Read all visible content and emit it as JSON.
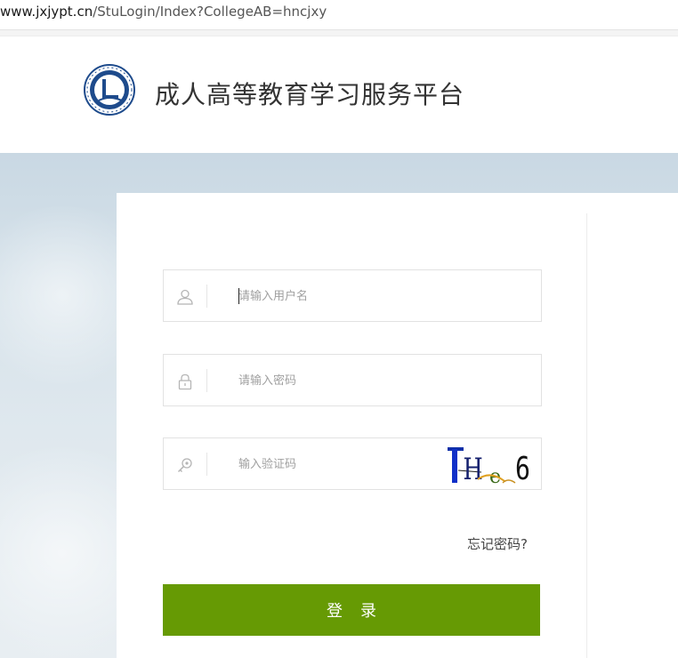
{
  "browser": {
    "url_host": "www.jxjypt.cn",
    "url_path": "/StuLogin/Index?CollegeAB=hncjxy"
  },
  "header": {
    "site_title": "成人高等教育学习服务平台",
    "logo_icon": "university-seal-icon"
  },
  "login_form": {
    "username": {
      "placeholder": "请输入用户名",
      "value": "",
      "icon": "user-icon"
    },
    "password": {
      "placeholder": "请输入密码",
      "value": "",
      "icon": "lock-icon"
    },
    "captcha": {
      "placeholder": "输入验证码",
      "value": "",
      "icon": "key-icon",
      "image_text": "THe6"
    },
    "forgot_password": "忘记密码?",
    "submit_label": "登录"
  },
  "colors": {
    "button": "#669a04",
    "field_border": "#e2e2e2"
  }
}
